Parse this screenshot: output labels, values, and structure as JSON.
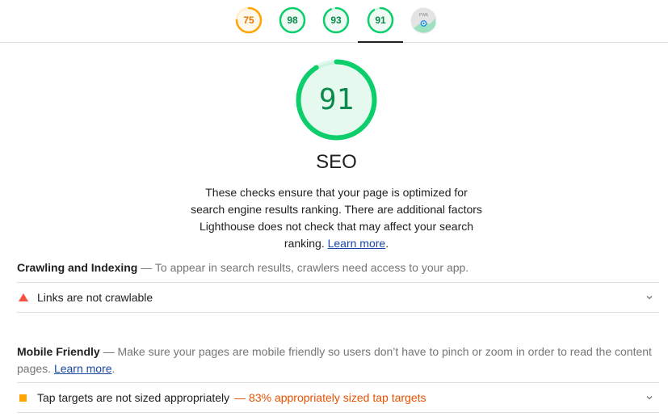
{
  "nav": {
    "scores": [
      {
        "value": "75",
        "color": "#ffa400",
        "fraction": 0.75
      },
      {
        "value": "98",
        "color": "#0cce6b",
        "fraction": 0.98
      },
      {
        "value": "93",
        "color": "#0cce6b",
        "fraction": 0.93
      },
      {
        "value": "91",
        "color": "#0cce6b",
        "fraction": 0.91
      }
    ],
    "pwa_label": "PWA",
    "active_index": 3
  },
  "category": {
    "score": "91",
    "score_fraction": 0.91,
    "title": "SEO",
    "description": "These checks ensure that your page is optimized for search engine results ranking. There are additional factors Lighthouse does not check that may affect your search ranking.",
    "learn_more": "Learn more",
    "trailing_period": "."
  },
  "groups": [
    {
      "title": "Crawling and Indexing",
      "separator": " — ",
      "description": "To appear in search results, crawlers need access to your app.",
      "audits": [
        {
          "title": "Links are not crawlable",
          "display_value": "",
          "status": "fail"
        }
      ]
    },
    {
      "title": "Mobile Friendly",
      "separator": " — ",
      "description": "Make sure your pages are mobile friendly so users don’t have to pinch or zoom in order to read the content pages.",
      "learn_more": "Learn more",
      "trailing_period": ".",
      "audits": [
        {
          "title": "Tap targets are not sized appropriately",
          "display_value": "— 83% appropriately sized tap targets",
          "status": "average"
        }
      ]
    }
  ],
  "colors": {
    "pass": "#0cce6b",
    "average": "#ffa400",
    "fail": "#ff4e42",
    "link": "#1a47a6"
  }
}
